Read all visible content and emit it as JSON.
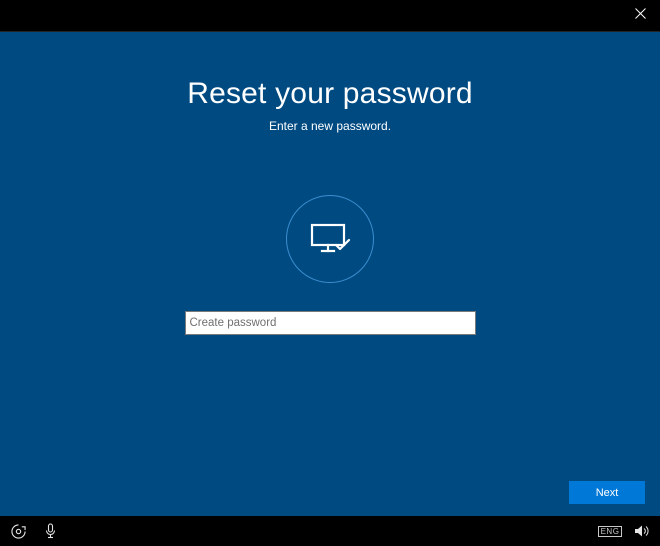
{
  "header": {
    "close_label": "Close"
  },
  "page": {
    "title": "Reset your password",
    "subtitle": "Enter a new password."
  },
  "form": {
    "password_value": "",
    "password_placeholder": "Create password"
  },
  "actions": {
    "next_label": "Next"
  },
  "taskbar": {
    "keyboard_layout": "ENG"
  },
  "icons": {
    "close": "close-icon",
    "device": "monitor-check-icon",
    "ease_of_access": "ease-of-access-icon",
    "microphone": "microphone-icon",
    "keyboard_layout": "keyboard-layout-indicator",
    "volume": "volume-icon"
  },
  "colors": {
    "background": "#004a82",
    "accent": "#0078d7",
    "ring": "#3b8ecf"
  }
}
